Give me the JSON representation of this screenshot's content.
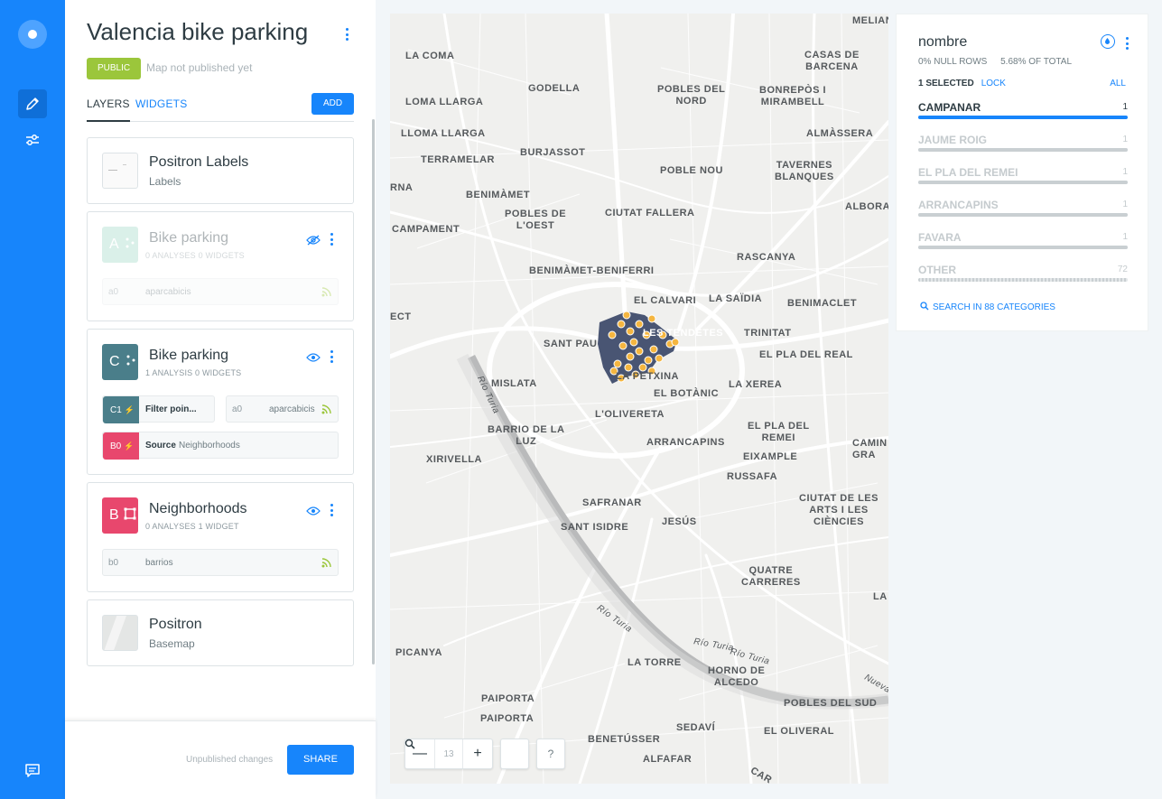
{
  "map_title": "Valencia bike parking",
  "privacy_badge": "PUBLIC",
  "publish_status": "Map not published yet",
  "tabs": {
    "layers": "LAYERS",
    "widgets": "WIDGETS",
    "add": "ADD"
  },
  "layers": [
    {
      "name": "Positron Labels",
      "sub": "Labels"
    },
    {
      "letter": "A",
      "name": "Bike parking",
      "meta": "0 ANALYSES   0 WIDGETS",
      "source_id": "a0",
      "source_name": "aparcabicis",
      "hidden": true
    },
    {
      "letter": "C",
      "name": "Bike parking",
      "meta": "1 ANALYSIS   0 WIDGETS",
      "analysis_id": "C1",
      "analysis_name": "Filter poin...",
      "source_id": "a0",
      "source_name": "aparcabicis",
      "b_id": "B0",
      "b_label": "Source",
      "b_value": "Neighborhoods"
    },
    {
      "letter": "B",
      "name": "Neighborhoods",
      "meta": "0 ANALYSES   1 WIDGET",
      "source_id": "b0",
      "source_name": "barrios"
    },
    {
      "name": "Positron",
      "sub": "Basemap"
    }
  ],
  "footer": {
    "status": "Unpublished changes",
    "share": "SHARE"
  },
  "map": {
    "zoom_level": "13",
    "zoom_out": "—",
    "zoom_in": "+",
    "help": "?",
    "places": {
      "la_coma": "LA COMA",
      "godella": "GODELLA",
      "pobles_nord": "POBLES DEL\nNORD",
      "bonrepos": "BONREPÒS I\nMIRAMBELL",
      "casas_barcena": "CASAS DE\nBARCENA",
      "meliana": "MELIAN",
      "loma_llarga": "LOMA LLARGA",
      "llloma": "LLOMA LLARGA",
      "almassera": "ALMÀSSERA",
      "terramelar": "TERRAMELAR",
      "burjassot": "BURJASSOT",
      "poble_nou": "POBLE NOU",
      "tavernes": "TAVERNES\nBLANQUES",
      "rna": "RNA",
      "benimamet": "BENIMÀMET",
      "pobles_oest": "POBLES DE\nL'OEST",
      "ciutat_fallera": "CIUTAT FALLERA",
      "albora": "ALBORA",
      "campament": "CAMPAMENT",
      "rascanya": "RASCANYA",
      "benimamet_beniferri": "BENIMÀMET-BENIFERRI",
      "el_calvari": "EL CALVARI",
      "la_saidia": "LA SAÏDIA",
      "benimaclet": "BENIMACLET",
      "sant_pau": "SANT PAU",
      "les_tendetes": "LES TENDETES",
      "trinitat": "TRINITAT",
      "el_pla_real": "EL PLA DEL REAL",
      "la_petxina": "LA PETXINA",
      "el_botanic": "EL BOTÀNIC",
      "mislata": "MISLATA",
      "la_xerea": "LA XEREA",
      "lolivereta": "L'OLIVERETA",
      "barrio_luz": "BARRIO DE LA\nLUZ",
      "arrancapins": "ARRANCAPINS",
      "el_pla_remei": "EL PLA DEL\nREMEI",
      "xirivella": "XIRIVELLA",
      "eixample": "EIXAMPLE",
      "camins": "CAMIN\nGRA",
      "russafa": "RUSSAFA",
      "safranar": "SAFRANAR",
      "ciutat_arts": "CIUTAT DE LES\nARTS I LES\nCIÈNCIES",
      "sant_isidre": "SANT ISIDRE",
      "jesus": "JESÚS",
      "quatre": "QUATRE\nCARRERES",
      "la": "LA",
      "picanya": "PICANYA",
      "la_torre": "LA TORRE",
      "horno": "HORNO DE\nALCEDO",
      "paiporta1": "PAIPORTA",
      "pobles_sud": "POBLES DEL SUD",
      "paiporta2": "PAIPORTA",
      "sedavi": "SEDAVÍ",
      "el_oliveral": "EL OLIVERAL",
      "benetusser": "BENETÚSSER",
      "alfafar": "ALFAFAR",
      "car": "CAR",
      "ect": "ECT",
      "rio_turia1": "Río Turia",
      "rio_turia2": "Río Turia",
      "rio_turia3": "Río Turia",
      "rio_turia4": "Río Turia",
      "nueva": "Nueva"
    }
  },
  "widget": {
    "title": "nombre",
    "null_rows": "0% NULL ROWS",
    "of_total": "5.68% OF TOTAL",
    "selected": "1 SELECTED",
    "lock": "LOCK",
    "all": "ALL",
    "categories": [
      {
        "name": "CAMPANAR",
        "count": "1",
        "fraction": 1.0,
        "selected": true
      },
      {
        "name": "JAUME ROIG",
        "count": "1",
        "fraction": 1.0,
        "selected": false
      },
      {
        "name": "EL PLA DEL REMEI",
        "count": "1",
        "fraction": 1.0,
        "selected": false
      },
      {
        "name": "ARRANCAPINS",
        "count": "1",
        "fraction": 1.0,
        "selected": false
      },
      {
        "name": "FAVARA",
        "count": "1",
        "fraction": 1.0,
        "selected": false
      },
      {
        "name": "OTHER",
        "count": "72",
        "fraction": 1.0,
        "selected": false
      }
    ],
    "search": "SEARCH IN 88 CATEGORIES"
  },
  "colors": {
    "accent": "#1785fb",
    "public": "#9bc63b",
    "layer_a": "#9fd8c6",
    "layer_c": "#4a7e8a",
    "layer_b": "#e8476d",
    "analysis_c": "#4a7e8a",
    "polygon": "#3f4c6b",
    "points": "#f5b640"
  }
}
